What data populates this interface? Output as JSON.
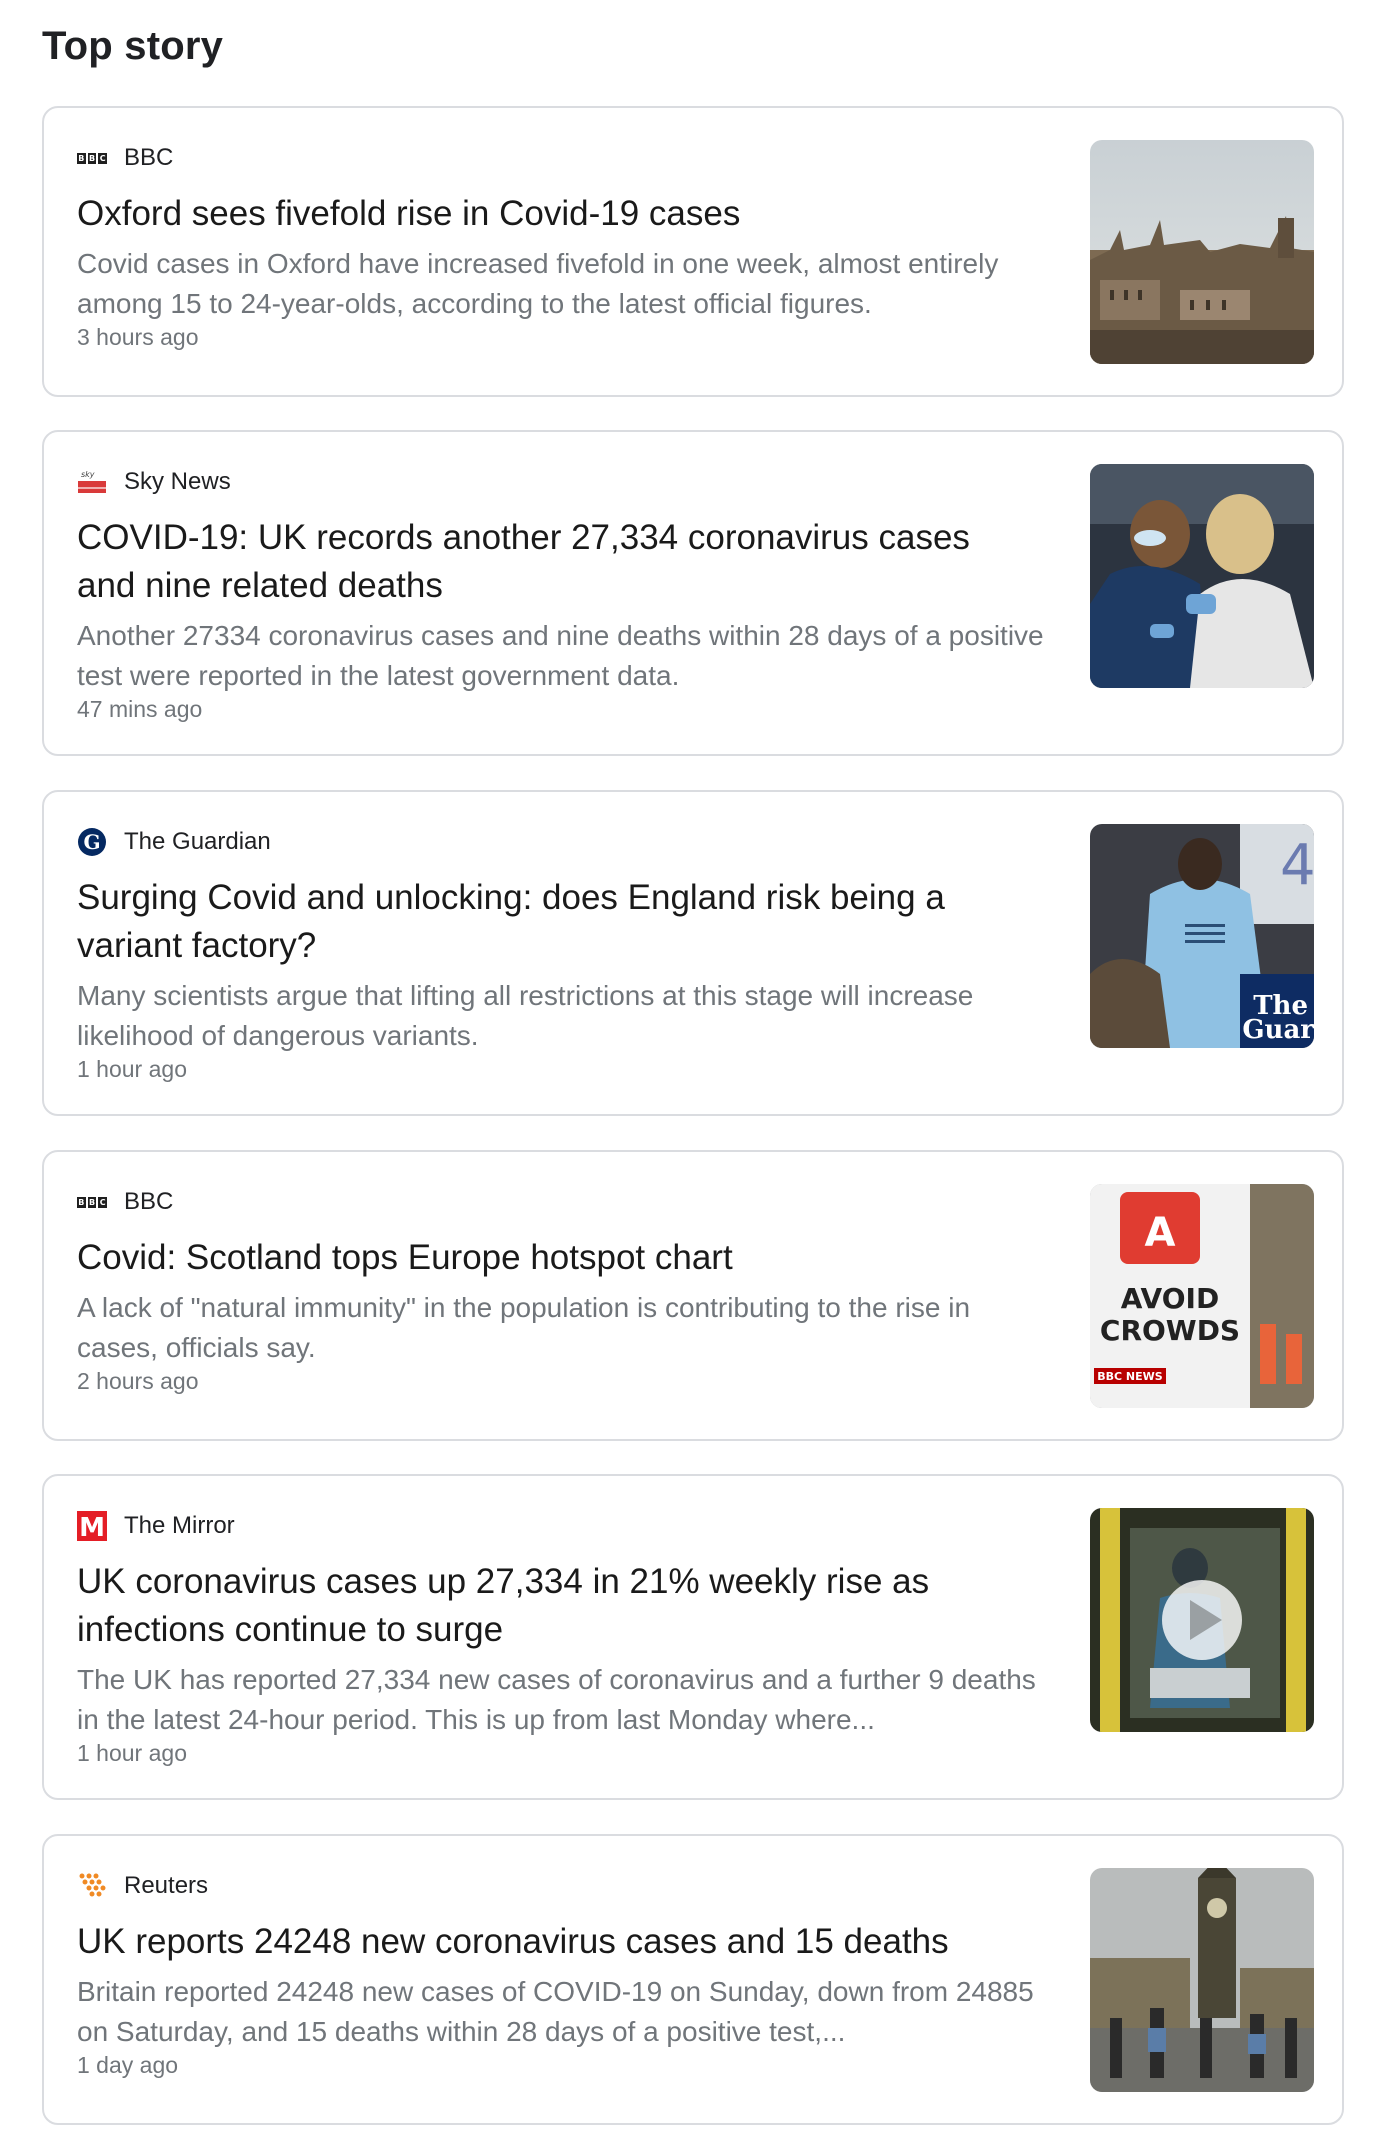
{
  "section_title": "Top story",
  "stories": [
    {
      "source": "BBC",
      "logo": "bbc-logo",
      "headline": [
        "Oxford sees fivefold rise in Covid-19 cases"
      ],
      "snippet": [
        "Covid cases in Oxford have increased fivefold in one week, almost entirely",
        "among 15 to 24-year-olds, according to the latest official figures."
      ],
      "time": "3 hours ago",
      "thumbnail": "oxford-skyline-image"
    },
    {
      "source": "Sky News",
      "logo": "sky-news-logo",
      "headline": [
        "COVID-19: UK records another 27,334 coronavirus cases",
        "and nine related deaths"
      ],
      "snippet": [
        "Another 27334 coronavirus cases and nine deaths within 28 days of a positive",
        "test were reported in the latest government data."
      ],
      "time": "47 mins ago",
      "thumbnail": "vaccination-image"
    },
    {
      "source": "The Guardian",
      "logo": "guardian-logo",
      "headline": [
        "Surging Covid and unlocking: does England risk being a",
        "variant factory?"
      ],
      "snippet": [
        "Many scientists argue that lifting all restrictions at this stage will increase",
        "likelihood of dangerous variants."
      ],
      "time": "1 hour ago",
      "thumbnail": "vaccination-centre-image"
    },
    {
      "source": "BBC",
      "logo": "bbc-logo",
      "headline": [
        "Covid: Scotland tops Europe hotspot chart"
      ],
      "snippet": [
        "A lack of \"natural immunity\" in the population is contributing to the rise in",
        "cases, officials say."
      ],
      "time": "2 hours ago",
      "thumbnail": "avoid-crowds-sign-image"
    },
    {
      "source": "The Mirror",
      "logo": "mirror-logo",
      "headline": [
        "UK coronavirus cases up 27,334 in 21% weekly rise as",
        "infections continue to surge"
      ],
      "snippet": [
        "The UK has reported 27,334 new cases of coronavirus and a further 9 deaths",
        "in the latest 24-hour period. This is up from last Monday where..."
      ],
      "time": "1 hour ago",
      "thumbnail": "ambulance-video-image"
    },
    {
      "source": "Reuters",
      "logo": "reuters-logo",
      "headline": [
        "UK reports 24248 new coronavirus cases and 15 deaths"
      ],
      "snippet": [
        "Britain reported 24248 new cases of COVID-19 on Sunday, down from 24885",
        "on Saturday, and 15 deaths within 28 days of a positive test,..."
      ],
      "time": "1 day ago",
      "thumbnail": "big-ben-street-image"
    }
  ],
  "image_text": {
    "avoid_crowds": [
      "AVOID",
      "CROWDS"
    ],
    "bbc_news_badge": "BBC NEWS",
    "guardian_watermark": [
      "The",
      "Guar"
    ],
    "thumb_number": "4"
  }
}
